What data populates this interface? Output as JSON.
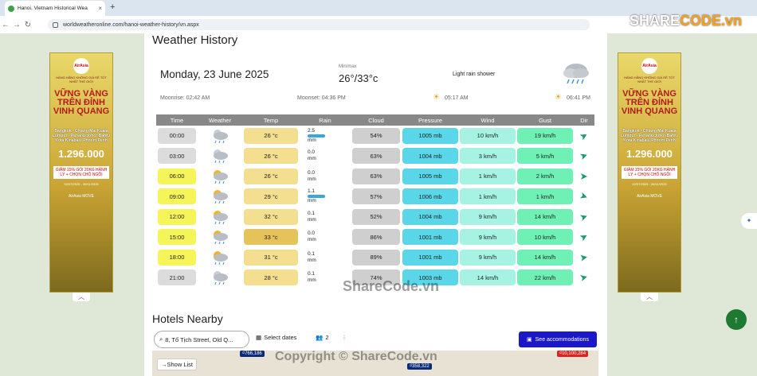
{
  "browser": {
    "tab_title": "Hanoi, Vietnam Historical Wea",
    "tab_close": "×",
    "new_tab": "+",
    "url": "worldweatheronline.com/hanoi-weather-history/vn.aspx"
  },
  "logo": {
    "prefix": "SHARE",
    "suffix": "CODE.vn"
  },
  "page": {
    "section_title": "Weather History",
    "date": "Monday, 23 June 2025",
    "minmax_label": "Min/max",
    "minmax_value": "26°/33°c",
    "description": "Light rain shower",
    "moonrise": "Moonrise: 02:42 AM",
    "moonset": "Moonset: 04:36 PM",
    "sunrise": "05:17 AM",
    "sunset": "06:41 PM"
  },
  "table": {
    "headers": [
      "Time",
      "Weather",
      "Temp",
      "Rain",
      "Cloud",
      "Pressure",
      "Wind",
      "Gust",
      "Dir"
    ],
    "rows": [
      {
        "time": "00:00",
        "temp": "26 °c",
        "rain": "2.5",
        "rain_unit": "mm",
        "cloud": "54%",
        "pressure": "1005 mb",
        "wind": "10 km/h",
        "gust": "19 km/h"
      },
      {
        "time": "03:00",
        "temp": "26 °c",
        "rain": "0.0",
        "rain_unit": "mm",
        "cloud": "63%",
        "pressure": "1004 mb",
        "wind": "3 km/h",
        "gust": "5 km/h"
      },
      {
        "time": "06:00",
        "temp": "26 °c",
        "rain": "0.0",
        "rain_unit": "mm",
        "cloud": "63%",
        "pressure": "1005 mb",
        "wind": "1 km/h",
        "gust": "2 km/h"
      },
      {
        "time": "09:00",
        "temp": "29 °c",
        "rain": "1.1",
        "rain_unit": "mm",
        "cloud": "57%",
        "pressure": "1006 mb",
        "wind": "1 km/h",
        "gust": "1 km/h"
      },
      {
        "time": "12:00",
        "temp": "32 °c",
        "rain": "0.1",
        "rain_unit": "mm",
        "cloud": "52%",
        "pressure": "1004 mb",
        "wind": "9 km/h",
        "gust": "14 km/h"
      },
      {
        "time": "15:00",
        "temp": "33 °c",
        "rain": "0.0",
        "rain_unit": "mm",
        "cloud": "86%",
        "pressure": "1001 mb",
        "wind": "9 km/h",
        "gust": "10 km/h"
      },
      {
        "time": "18:00",
        "temp": "31 °c",
        "rain": "0.1",
        "rain_unit": "mm",
        "cloud": "89%",
        "pressure": "1001 mb",
        "wind": "9 km/h",
        "gust": "14 km/h"
      },
      {
        "time": "21:00",
        "temp": "28 °c",
        "rain": "0.1",
        "rain_unit": "mm",
        "cloud": "74%",
        "pressure": "1003 mb",
        "wind": "14 km/h",
        "gust": "22 km/h"
      }
    ]
  },
  "hotels": {
    "title": "Hotels Nearby",
    "search_value": "8, Tố Tịch Street, Old Q...",
    "dates_label": "Select dates",
    "guests": "2",
    "cta": "See accommodations",
    "show_list": "Show List",
    "map_prices": [
      "₫358,322",
      "₫10,100,284",
      "₫766,186"
    ]
  },
  "ads": {
    "brand": "AirAsia",
    "headline": "VỮNG VÀNG TRÊN ĐỈNH VINH QUANG",
    "tagline": "HÀNG HÃNG KHÔNG GIÁ RẺ TỐT NHẤT THẾ GIỚI",
    "routes": "Bangkok - Chiang Mai Kuala Lumpur - Penang Johor Bahru Kota Kinabalu Phnom Penh",
    "price": "1.296.000",
    "coupon": "GIẢM 15% GÓI 20KG HÀNH LÝ + CHỌN CHỖ NGỒI",
    "period": "02/07/2025 - 30/11/2025",
    "move": "AirAsia MOVE"
  },
  "watermark": "ShareCode.vn",
  "copyright": "Copyright © ShareCode.vn",
  "colors": {
    "temp_light": "#f3df8f",
    "temp_dark": "#e6c35a",
    "time_yellow": "#f5f55a",
    "time_gray": "#dcdcdc",
    "cloud_gray": "#cfcfcf",
    "pressure_cyan": "#59d7e8",
    "wind_mint": "#a6f3e3",
    "gust_green": "#6ff0b5",
    "accent_blue": "#1a18c8"
  }
}
